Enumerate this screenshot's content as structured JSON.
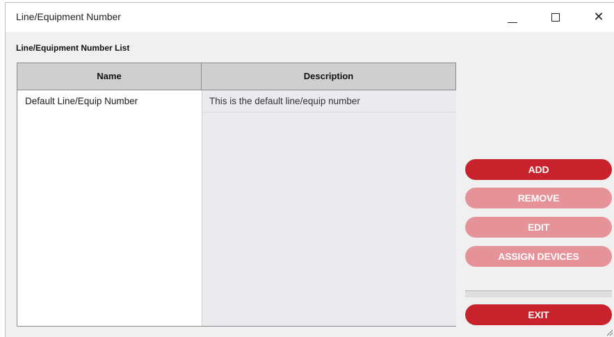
{
  "window": {
    "title": "Line/Equipment Number"
  },
  "section_label": "Line/Equipment Number List",
  "table": {
    "columns": [
      "Name",
      "Description"
    ],
    "rows": [
      {
        "name": "Default Line/Equip Number",
        "description": "This is the default line/equip number"
      }
    ]
  },
  "buttons": {
    "add": "ADD",
    "remove": "REMOVE",
    "edit": "EDIT",
    "assign_devices": "ASSIGN DEVICES",
    "exit": "EXIT"
  },
  "colors": {
    "button_active": "#c8232d",
    "button_disabled": "#e59398"
  }
}
